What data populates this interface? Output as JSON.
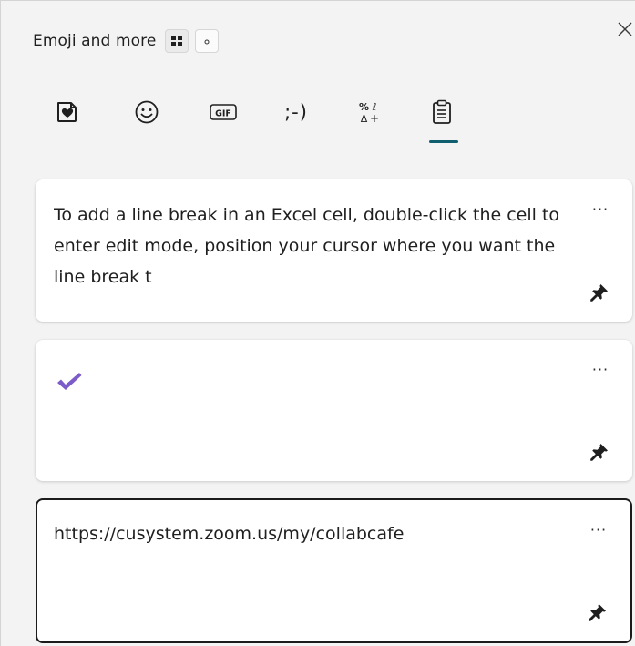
{
  "header": {
    "title": "Emoji and more",
    "mode_buttons": [
      {
        "icon": "grid-icon",
        "pressed": true
      },
      {
        "icon": "compact-dot-icon",
        "pressed": false
      }
    ],
    "close_icon": "close-icon"
  },
  "tabs": [
    {
      "name": "most-used",
      "icon": "heart-sticker-icon"
    },
    {
      "name": "emoji",
      "icon": "smiley-icon"
    },
    {
      "name": "gif",
      "icon": "gif-icon"
    },
    {
      "name": "kaomoji",
      "label": ";-)"
    },
    {
      "name": "symbols",
      "icon": "symbols-icon"
    },
    {
      "name": "clipboard",
      "icon": "clipboard-icon",
      "active": true
    }
  ],
  "accent_color": "#0f5e6e",
  "clipboard": {
    "items": [
      {
        "text": "To add a line break in an Excel cell, double-click the cell to enter edit mode, position your cursor where you want the line break t",
        "more_label": "···"
      },
      {
        "text": "",
        "icon": "checkmark-icon",
        "icon_color": "#7b5cc8",
        "more_label": "···"
      },
      {
        "text": "https://cusystem.zoom.us/my/collabcafe",
        "more_label": "···",
        "selected": true
      }
    ]
  }
}
